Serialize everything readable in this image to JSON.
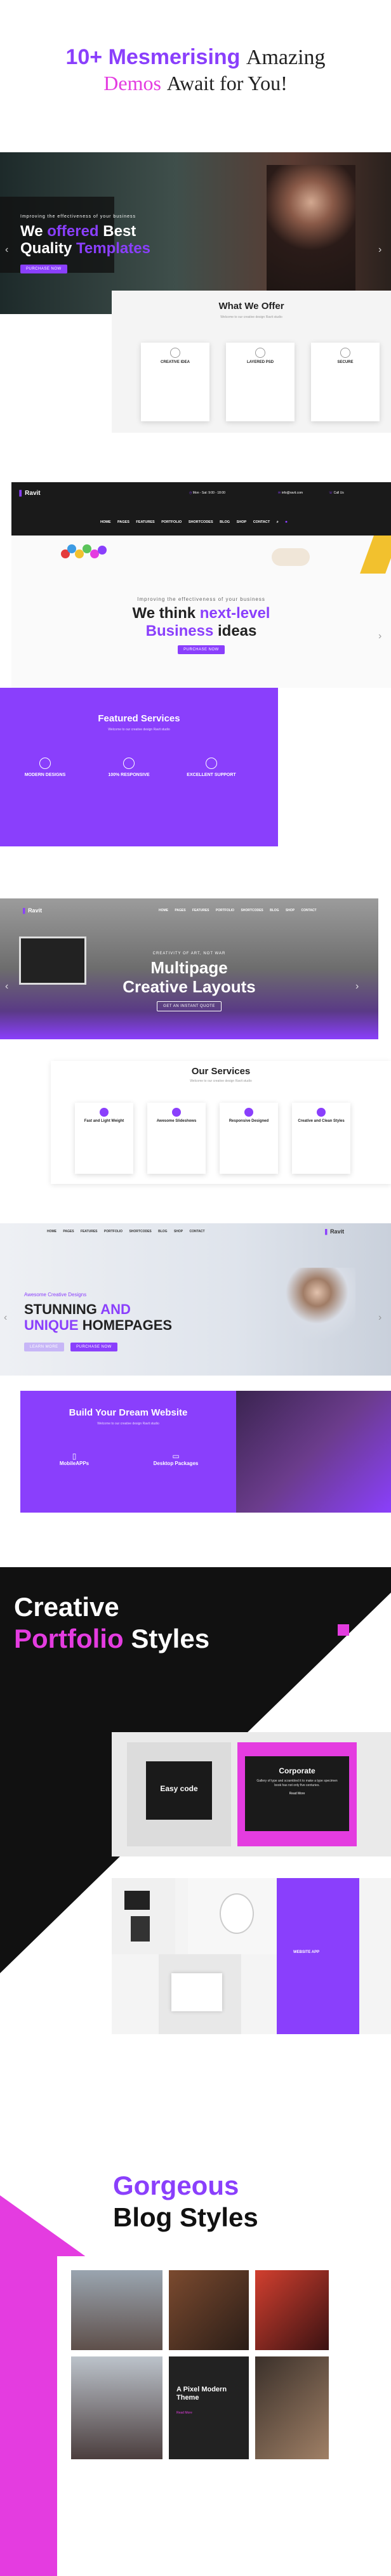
{
  "headline": {
    "count": "10+",
    "word1": "Mesmerising",
    "word2": "Amazing",
    "line2a": "Demos",
    "line2b": "Await for You!"
  },
  "demo1": {
    "tagline": "Improving the effectiveness of your business",
    "title1": "We",
    "title2": "offered",
    "title3": "Best",
    "title4": "Quality",
    "title5": "Templates",
    "button": "Purchase now",
    "offer_title": "What We Offer",
    "offer_sub": "Welcome to our creative design Ravit studio",
    "cards": [
      {
        "title": "CREATIVE IDEA",
        "icon": "lightbulb-icon"
      },
      {
        "title": "LAYERED PSD",
        "icon": "layers-icon"
      },
      {
        "title": "SECURE",
        "icon": "lock-icon"
      }
    ]
  },
  "demo2": {
    "logo": "Ravit",
    "contact1": "Mon - Sat: 9:00 - 18:00",
    "contact2": "info@ravit.com",
    "contact3": "Call Us",
    "nav": [
      "HOME",
      "PAGES",
      "FEATURES",
      "PORTFOLIO",
      "SHORTCODES",
      "BLOG",
      "SHOP",
      "CONTACT"
    ],
    "tagline": "Improving the effectiveness of your business",
    "title1": "We think",
    "title2": "next-level",
    "title3": "Business",
    "title4": "ideas",
    "button": "Purchase now",
    "services_title": "Featured Services",
    "services_sub": "Welcome to our creative design Ravit studio",
    "services": [
      {
        "title": "MODERN DESIGNS",
        "icon": "monitor-icon"
      },
      {
        "title": "100% RESPONSIVE",
        "icon": "devices-icon"
      },
      {
        "title": "EXCELLENT SUPPORT",
        "icon": "support-icon"
      }
    ]
  },
  "demo3": {
    "logo": "Ravit",
    "nav": [
      "HOME",
      "PAGES",
      "FEATURES",
      "PORTFOLIO",
      "SHORTCODES",
      "BLOG",
      "SHOP",
      "CONTACT"
    ],
    "tagline": "CREATIVITY OF ART, NOT WAR",
    "title1": "Multipage",
    "title2": "Creative Layouts",
    "button": "Get an instant quote",
    "services_title": "Our Services",
    "services_sub": "Welcome to our creative design Ravit studio",
    "cards": [
      {
        "title": "Fast and Light Weight",
        "icon": "rocket-icon"
      },
      {
        "title": "Awesome Slideshows",
        "icon": "slides-icon"
      },
      {
        "title": "Responsive Designed",
        "icon": "responsive-icon"
      },
      {
        "title": "Creative and Clean Styles",
        "icon": "brush-icon"
      }
    ]
  },
  "demo4": {
    "logo": "Ravit",
    "nav": [
      "HOME",
      "PAGES",
      "FEATURES",
      "PORTFOLIO",
      "SHORTCODES",
      "BLOG",
      "SHOP",
      "CONTACT"
    ],
    "tagline": "Awesome Creative Designs",
    "title1": "STUNNING",
    "title2": "AND",
    "title3": "UNIQUE",
    "title4": "HOMEPAGES",
    "button1": "Learn more",
    "button2": "Purchase now",
    "build_title": "Build Your Dream Website",
    "build_sub": "Welcome to our creative design Ravit studio",
    "features": [
      {
        "title": "MobileAPPs",
        "icon": "phone-icon"
      },
      {
        "title": "Desktop Packages",
        "icon": "desktop-icon"
      }
    ]
  },
  "portfolio": {
    "word1": "Creative",
    "word2": "Portfolio",
    "word3": "Styles",
    "card1": "Easy code",
    "card2_title": "Corporate",
    "card2_text": "Gallery of type and scrambled it to make a type specimen book has not only five centuries.",
    "card2_link": "Read More",
    "card3": "WEBSITE APP"
  },
  "blog": {
    "word1": "Gorgeous",
    "word2": "Blog Styles",
    "post_title": "A Pixel Modern Theme",
    "post_link": "Read More"
  },
  "colors": {
    "purple": "#8a3ffc",
    "magenta": "#e43ce0",
    "dark": "#1a1a1a"
  }
}
